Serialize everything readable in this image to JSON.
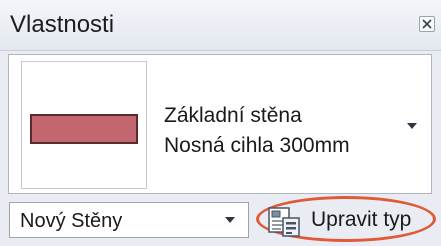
{
  "panel": {
    "title": "Vlastnosti",
    "close_icon": "close-icon"
  },
  "type_selector": {
    "family": "Základní stěna",
    "type_name": "Nosná cihla 300mm",
    "swatch_fill": "#c2666f",
    "swatch_border": "#5a2a2f",
    "dropdown_icon": "chevron-down-icon"
  },
  "instance_filter": {
    "selected": "Nový Stěny",
    "dropdown_icon": "chevron-down-icon"
  },
  "edit_type": {
    "label": "Upravit typ",
    "icon": "edit-type-icon",
    "highlight_color": "#e05a3a"
  }
}
